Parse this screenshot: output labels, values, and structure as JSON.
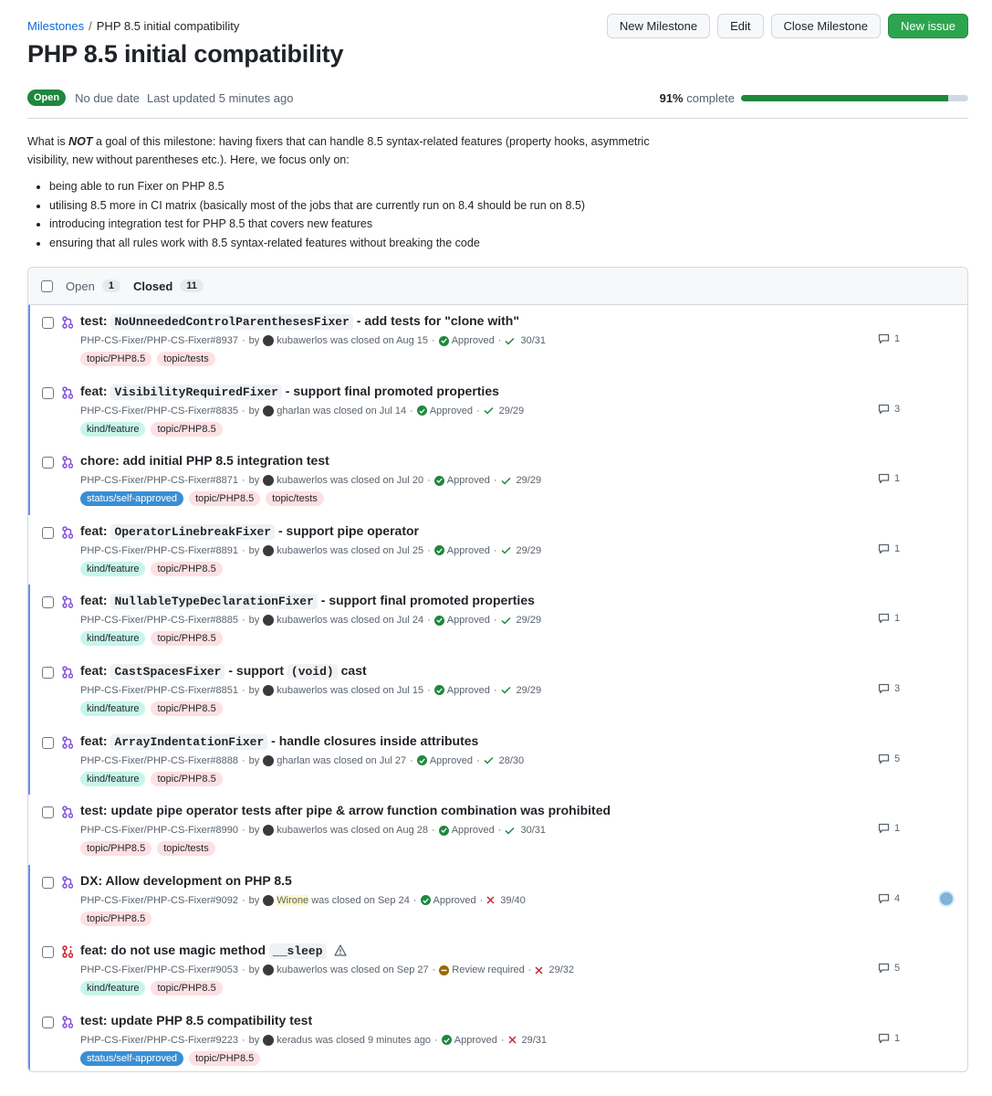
{
  "breadcrumb": {
    "milestones": "Milestones",
    "sep": "/",
    "current": "PHP 8.5 initial compatibility"
  },
  "title": "PHP 8.5 initial compatibility",
  "buttons": {
    "new_milestone": "New Milestone",
    "edit": "Edit",
    "close": "Close Milestone",
    "new_issue": "New issue"
  },
  "meta": {
    "state": "Open",
    "due": "No due date",
    "updated": "Last updated 5 minutes ago",
    "percent": "91%",
    "complete": "complete",
    "progress_fraction": 0.91
  },
  "description": {
    "p1_a": "What is ",
    "p1_not": "NOT",
    "p1_b": " a goal of this milestone: having fixers that can handle 8.5 syntax-related features (property hooks, asymmetric visibility, new without parentheses etc.). Here, we focus only on:",
    "bullets": [
      "being able to run Fixer on PHP 8.5",
      "utilising 8.5 more in CI matrix (basically most of the jobs that are currently run on 8.4 should be run on 8.5)",
      "introducing integration test for PHP 8.5 that covers new features",
      "ensuring that all rules work with 8.5 syntax-related features without breaking the code"
    ]
  },
  "filters": {
    "open_label": "Open",
    "open_count": "1",
    "closed_label": "Closed",
    "closed_count": "11"
  },
  "items": [
    {
      "pre": "test: ",
      "code": "NoUnneededControlParenthesesFixer",
      "post": " - add tests for \"clone with\"",
      "ref": "PHP-CS-Fixer/PHP-CS-Fixer#8937",
      "author": "kubawerlos",
      "closed": "was closed on Aug 15",
      "review": "Approved",
      "checks": "30/31",
      "checks_ok": true,
      "comments": "1",
      "labels": [
        "topic/PHP8.5",
        "topic/tests"
      ],
      "hl": true
    },
    {
      "pre": "feat: ",
      "code": "VisibilityRequiredFixer",
      "post": " - support final promoted properties",
      "ref": "PHP-CS-Fixer/PHP-CS-Fixer#8835",
      "author": "gharlan",
      "closed": "was closed on Jul 14",
      "review": "Approved",
      "checks": "29/29",
      "checks_ok": true,
      "comments": "3",
      "labels": [
        "kind/feature",
        "topic/PHP8.5"
      ],
      "hl": true
    },
    {
      "pre": "chore: add initial PHP 8.5 integration test",
      "code": "",
      "post": "",
      "ref": "PHP-CS-Fixer/PHP-CS-Fixer#8871",
      "author": "kubawerlos",
      "closed": "was closed on Jul 20",
      "review": "Approved",
      "checks": "29/29",
      "checks_ok": true,
      "comments": "1",
      "labels": [
        "status/self-approved",
        "topic/PHP8.5",
        "topic/tests"
      ],
      "hl": true
    },
    {
      "pre": "feat: ",
      "code": "OperatorLinebreakFixer",
      "post": " - support pipe operator",
      "ref": "PHP-CS-Fixer/PHP-CS-Fixer#8891",
      "author": "kubawerlos",
      "closed": "was closed on Jul 25",
      "review": "Approved",
      "checks": "29/29",
      "checks_ok": true,
      "comments": "1",
      "labels": [
        "kind/feature",
        "topic/PHP8.5"
      ],
      "hl": false
    },
    {
      "pre": "feat: ",
      "code": "NullableTypeDeclarationFixer",
      "post": " - support final promoted properties",
      "ref": "PHP-CS-Fixer/PHP-CS-Fixer#8885",
      "author": "kubawerlos",
      "closed": "was closed on Jul 24",
      "review": "Approved",
      "checks": "29/29",
      "checks_ok": true,
      "comments": "1",
      "labels": [
        "kind/feature",
        "topic/PHP8.5"
      ],
      "hl": true
    },
    {
      "pre": "feat: ",
      "code": "CastSpacesFixer",
      "post": " - support ",
      "code2": "(void)",
      "post2": " cast",
      "ref": "PHP-CS-Fixer/PHP-CS-Fixer#8851",
      "author": "kubawerlos",
      "closed": "was closed on Jul 15",
      "review": "Approved",
      "checks": "29/29",
      "checks_ok": true,
      "comments": "3",
      "labels": [
        "kind/feature",
        "topic/PHP8.5"
      ],
      "hl": true
    },
    {
      "pre": "feat: ",
      "code": "ArrayIndentationFixer",
      "post": " - handle closures inside attributes",
      "ref": "PHP-CS-Fixer/PHP-CS-Fixer#8888",
      "author": "gharlan",
      "closed": "was closed on Jul 27",
      "review": "Approved",
      "checks": "28/30",
      "checks_ok": true,
      "comments": "5",
      "labels": [
        "kind/feature",
        "topic/PHP8.5"
      ],
      "hl": true
    },
    {
      "pre": "test: update pipe operator tests after pipe & arrow function combination was prohibited",
      "code": "",
      "post": "",
      "ref": "PHP-CS-Fixer/PHP-CS-Fixer#8990",
      "author": "kubawerlos",
      "closed": "was closed on Aug 28",
      "review": "Approved",
      "checks": "30/31",
      "checks_ok": true,
      "comments": "1",
      "labels": [
        "topic/PHP8.5",
        "topic/tests"
      ],
      "hl": false
    },
    {
      "pre": "DX: Allow development on PHP 8.5",
      "code": "",
      "post": "",
      "ref": "PHP-CS-Fixer/PHP-CS-Fixer#9092",
      "author": "Wirone",
      "closed": "was closed on Sep 24",
      "review": "Approved",
      "checks": "39/40",
      "checks_ok": false,
      "comments": "4",
      "labels": [
        "topic/PHP8.5"
      ],
      "hl": true,
      "assignee": true,
      "author_hl": true
    },
    {
      "pre": "feat: do not use magic method ",
      "code": "__sleep",
      "post": "",
      "ref": "PHP-CS-Fixer/PHP-CS-Fixer#9053",
      "author": "kubawerlos",
      "closed": "was closed on Sep 27",
      "review": "Review required",
      "checks": "29/32",
      "checks_ok": false,
      "comments": "5",
      "labels": [
        "kind/feature",
        "topic/PHP8.5"
      ],
      "hl": true,
      "warn": true,
      "closed_unmerged": true
    },
    {
      "pre": "test: update PHP 8.5 compatibility test",
      "code": "",
      "post": "",
      "ref": "PHP-CS-Fixer/PHP-CS-Fixer#9223",
      "author": "keradus",
      "closed": "was closed 9 minutes ago",
      "review": "Approved",
      "checks": "29/31",
      "checks_ok": false,
      "comments": "1",
      "labels": [
        "status/self-approved",
        "topic/PHP8.5"
      ],
      "hl": true
    }
  ]
}
